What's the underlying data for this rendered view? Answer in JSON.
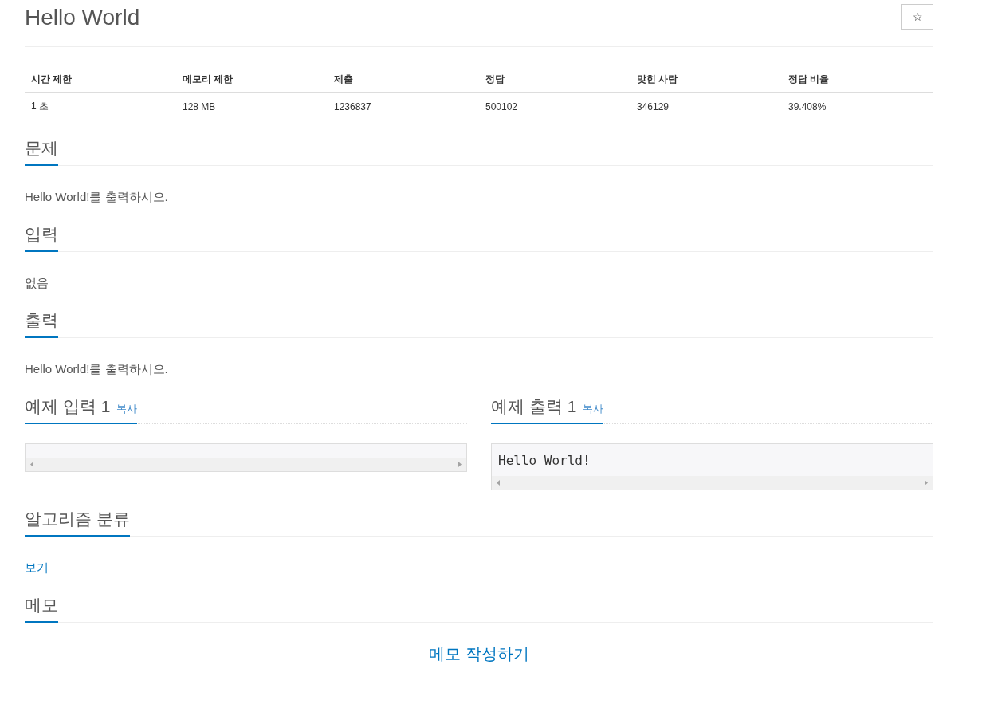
{
  "title": "Hello World",
  "star_button": {
    "label": "☆"
  },
  "stats": {
    "columns": [
      "시간 제한",
      "메모리 제한",
      "제출",
      "정답",
      "맞힌 사람",
      "정답 비율"
    ],
    "rows": [
      [
        "1 초",
        "128 MB",
        "1236837",
        "500102",
        "346129",
        "39.408%"
      ]
    ]
  },
  "blocks": [
    {
      "kind": "text",
      "heading": "문제",
      "text": "Hello World!를 출력하시오."
    },
    {
      "kind": "text",
      "heading": "입력",
      "text": "없음"
    },
    {
      "kind": "text",
      "heading": "출력",
      "text": "Hello World!를 출력하시오."
    },
    {
      "kind": "samples",
      "samples": [
        {
          "heading": "예제 입력 1",
          "copy_link": "복사"
        },
        {
          "heading": "예제 출력 1",
          "copy_link": "복사",
          "content": "Hello World!"
        }
      ]
    },
    {
      "kind": "link",
      "heading": "알고리즘 분류",
      "link": "보기"
    },
    {
      "kind": "action",
      "heading": "메모",
      "link": "메모 작성하기"
    }
  ]
}
